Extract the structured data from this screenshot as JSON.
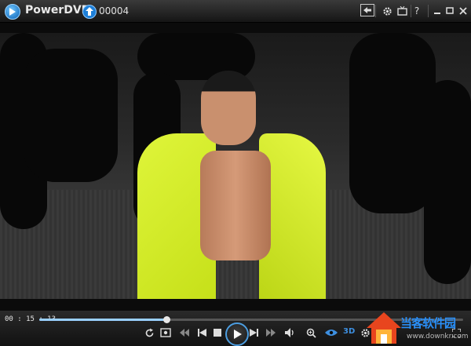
{
  "titlebar": {
    "app_title": "PowerDVD",
    "file_name": "00004",
    "icons": [
      "powerdvd-logo-icon",
      "upload-icon",
      "back-mode-icon",
      "settings-icon",
      "tv-mode-icon",
      "help-icon",
      "minimize-icon",
      "maximize-icon",
      "close-icon"
    ],
    "help_label": "?"
  },
  "player": {
    "current_time": "00 : 15 : 13",
    "progress_fraction": 0.3
  },
  "controls": {
    "label_3d": "3D",
    "accent_color": "#3d8fe0"
  },
  "watermark": {
    "text": "当客软件园",
    "url": "www.downkr.com"
  }
}
